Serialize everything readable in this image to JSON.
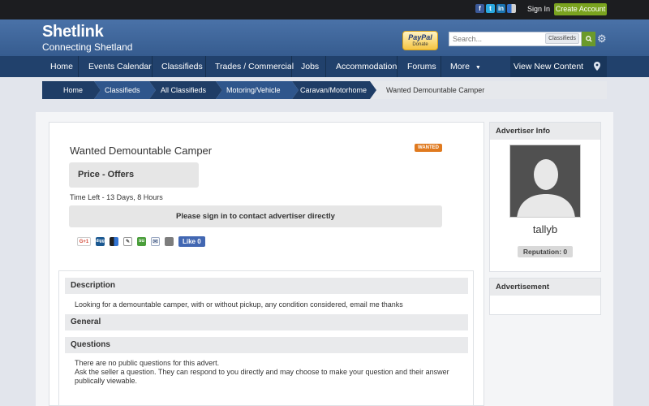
{
  "topbar": {
    "social_icons": [
      "facebook-icon",
      "twitter-icon",
      "linkedin-icon",
      "delicious-icon"
    ],
    "sign_in": "Sign In",
    "create_account": "Create Account"
  },
  "header": {
    "logo_title": "Shetlink",
    "logo_tagline": "Connecting Shetland",
    "paypal": "PayPal",
    "paypal_sub": "Donate",
    "search_placeholder": "Search...",
    "search_scope": "Classifieds"
  },
  "nav": {
    "items": [
      "Home",
      "Events Calendar",
      "Classifieds",
      "Trades / Commercial",
      "Jobs",
      "Accommodation",
      "Forums",
      "More"
    ],
    "more_icon": "chevron-down-icon",
    "view_new": "View New Content",
    "pin_icon": "map-pin-icon"
  },
  "breadcrumb": {
    "items": [
      "Home",
      "Classifieds",
      "All Classifieds",
      "Motoring/Vehicle",
      "Caravan/Motorhome"
    ],
    "current": "Wanted Demountable Camper"
  },
  "ad": {
    "title": "Wanted Demountable Camper",
    "badge": "WANTED",
    "price": "Price - Offers",
    "time_left": "Time Left - 13 Days, 8 Hours",
    "contact": "Please sign in to contact advertiser directly",
    "share_icons": [
      "google-plus-icon",
      "digg-icon",
      "delicious-icon",
      "pinterest-icon",
      "stumbleupon-icon",
      "email-icon",
      "print-icon"
    ],
    "google_plus": "G+1",
    "digg": "digg",
    "stumble": "su",
    "fb_like": "Like 0"
  },
  "sections": {
    "description_h": "Description",
    "description_t": "Looking for a demountable camper, with or without pickup, any condition considered, email me thanks",
    "general_h": "General",
    "questions_h": "Questions",
    "questions_t1": "There are no public questions for this advert.",
    "questions_t2": "Ask the seller a question. They can respond to you directly and may choose to make your question and their answer publically viewable."
  },
  "sidebar": {
    "advertiser_h": "Advertiser Info",
    "username": "tallyb",
    "reputation": "Reputation: 0",
    "advertisement_h": "Advertisement"
  },
  "colors": {
    "nav_bg": "#21416c",
    "header_bg": "#4a72a8",
    "create_btn": "#7aa31f",
    "wanted_badge": "#e07a1f",
    "breadcrumb_dark": "#1f3d66",
    "breadcrumb_light": "#2f568c"
  }
}
